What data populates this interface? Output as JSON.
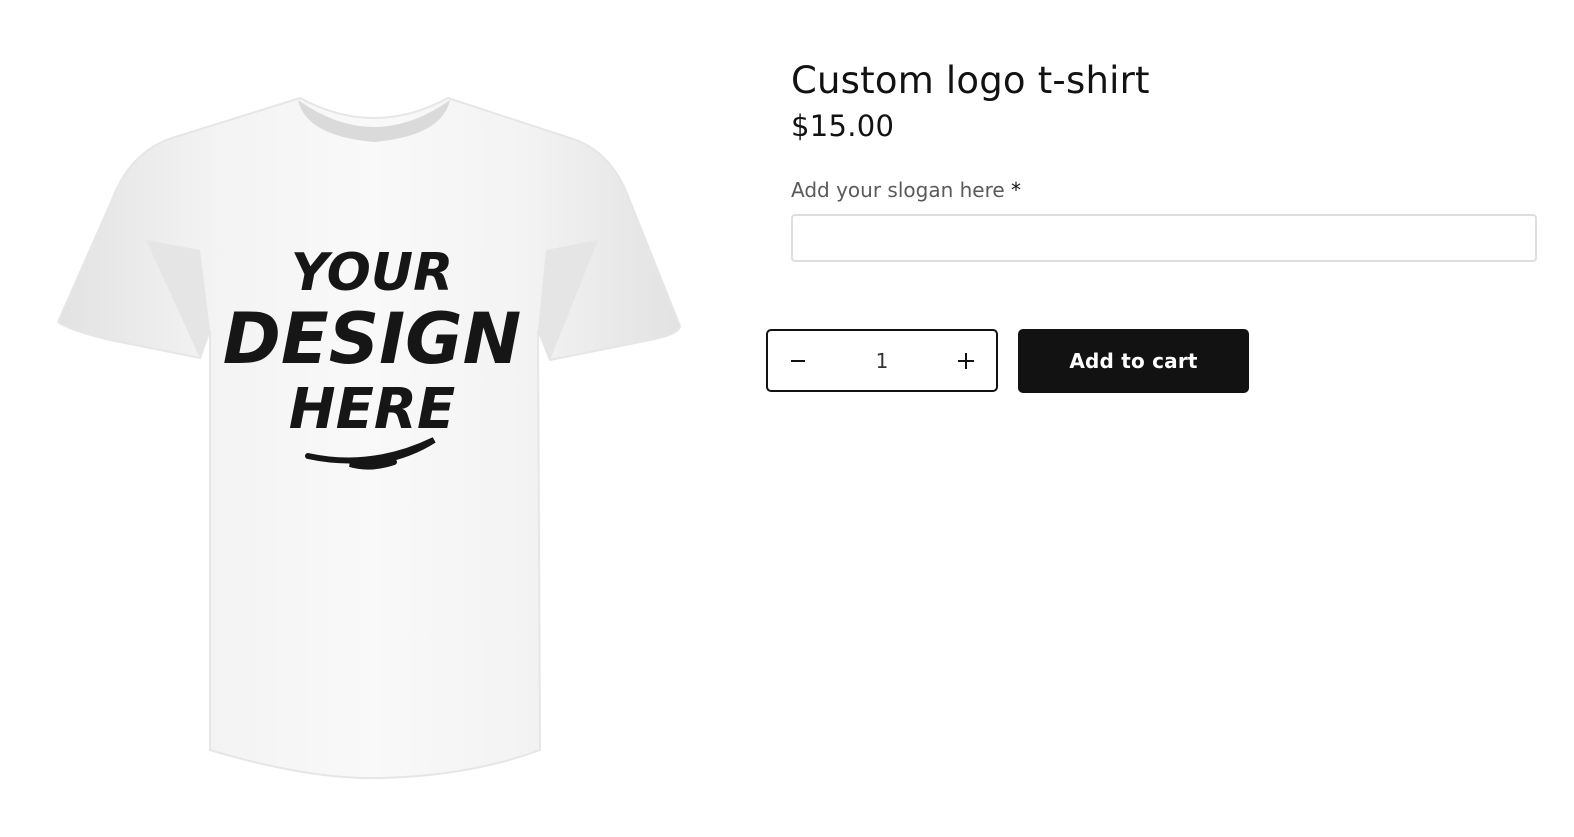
{
  "product": {
    "image": {
      "alt": "White t-shirt mockup",
      "print_lines": [
        "YOUR",
        "DESIGN",
        "HERE"
      ]
    },
    "title": "Custom logo t-shirt",
    "price": "$15.00"
  },
  "slogan_field": {
    "label": "Add your slogan here",
    "required_marker": "*",
    "value": ""
  },
  "quantity": {
    "value": "1",
    "decrease_icon": "minus-icon",
    "increase_icon": "plus-icon"
  },
  "cart": {
    "add_label": "Add to cart"
  },
  "colors": {
    "primary": "#121212",
    "background": "#ffffff",
    "input_border": "#dedede"
  }
}
